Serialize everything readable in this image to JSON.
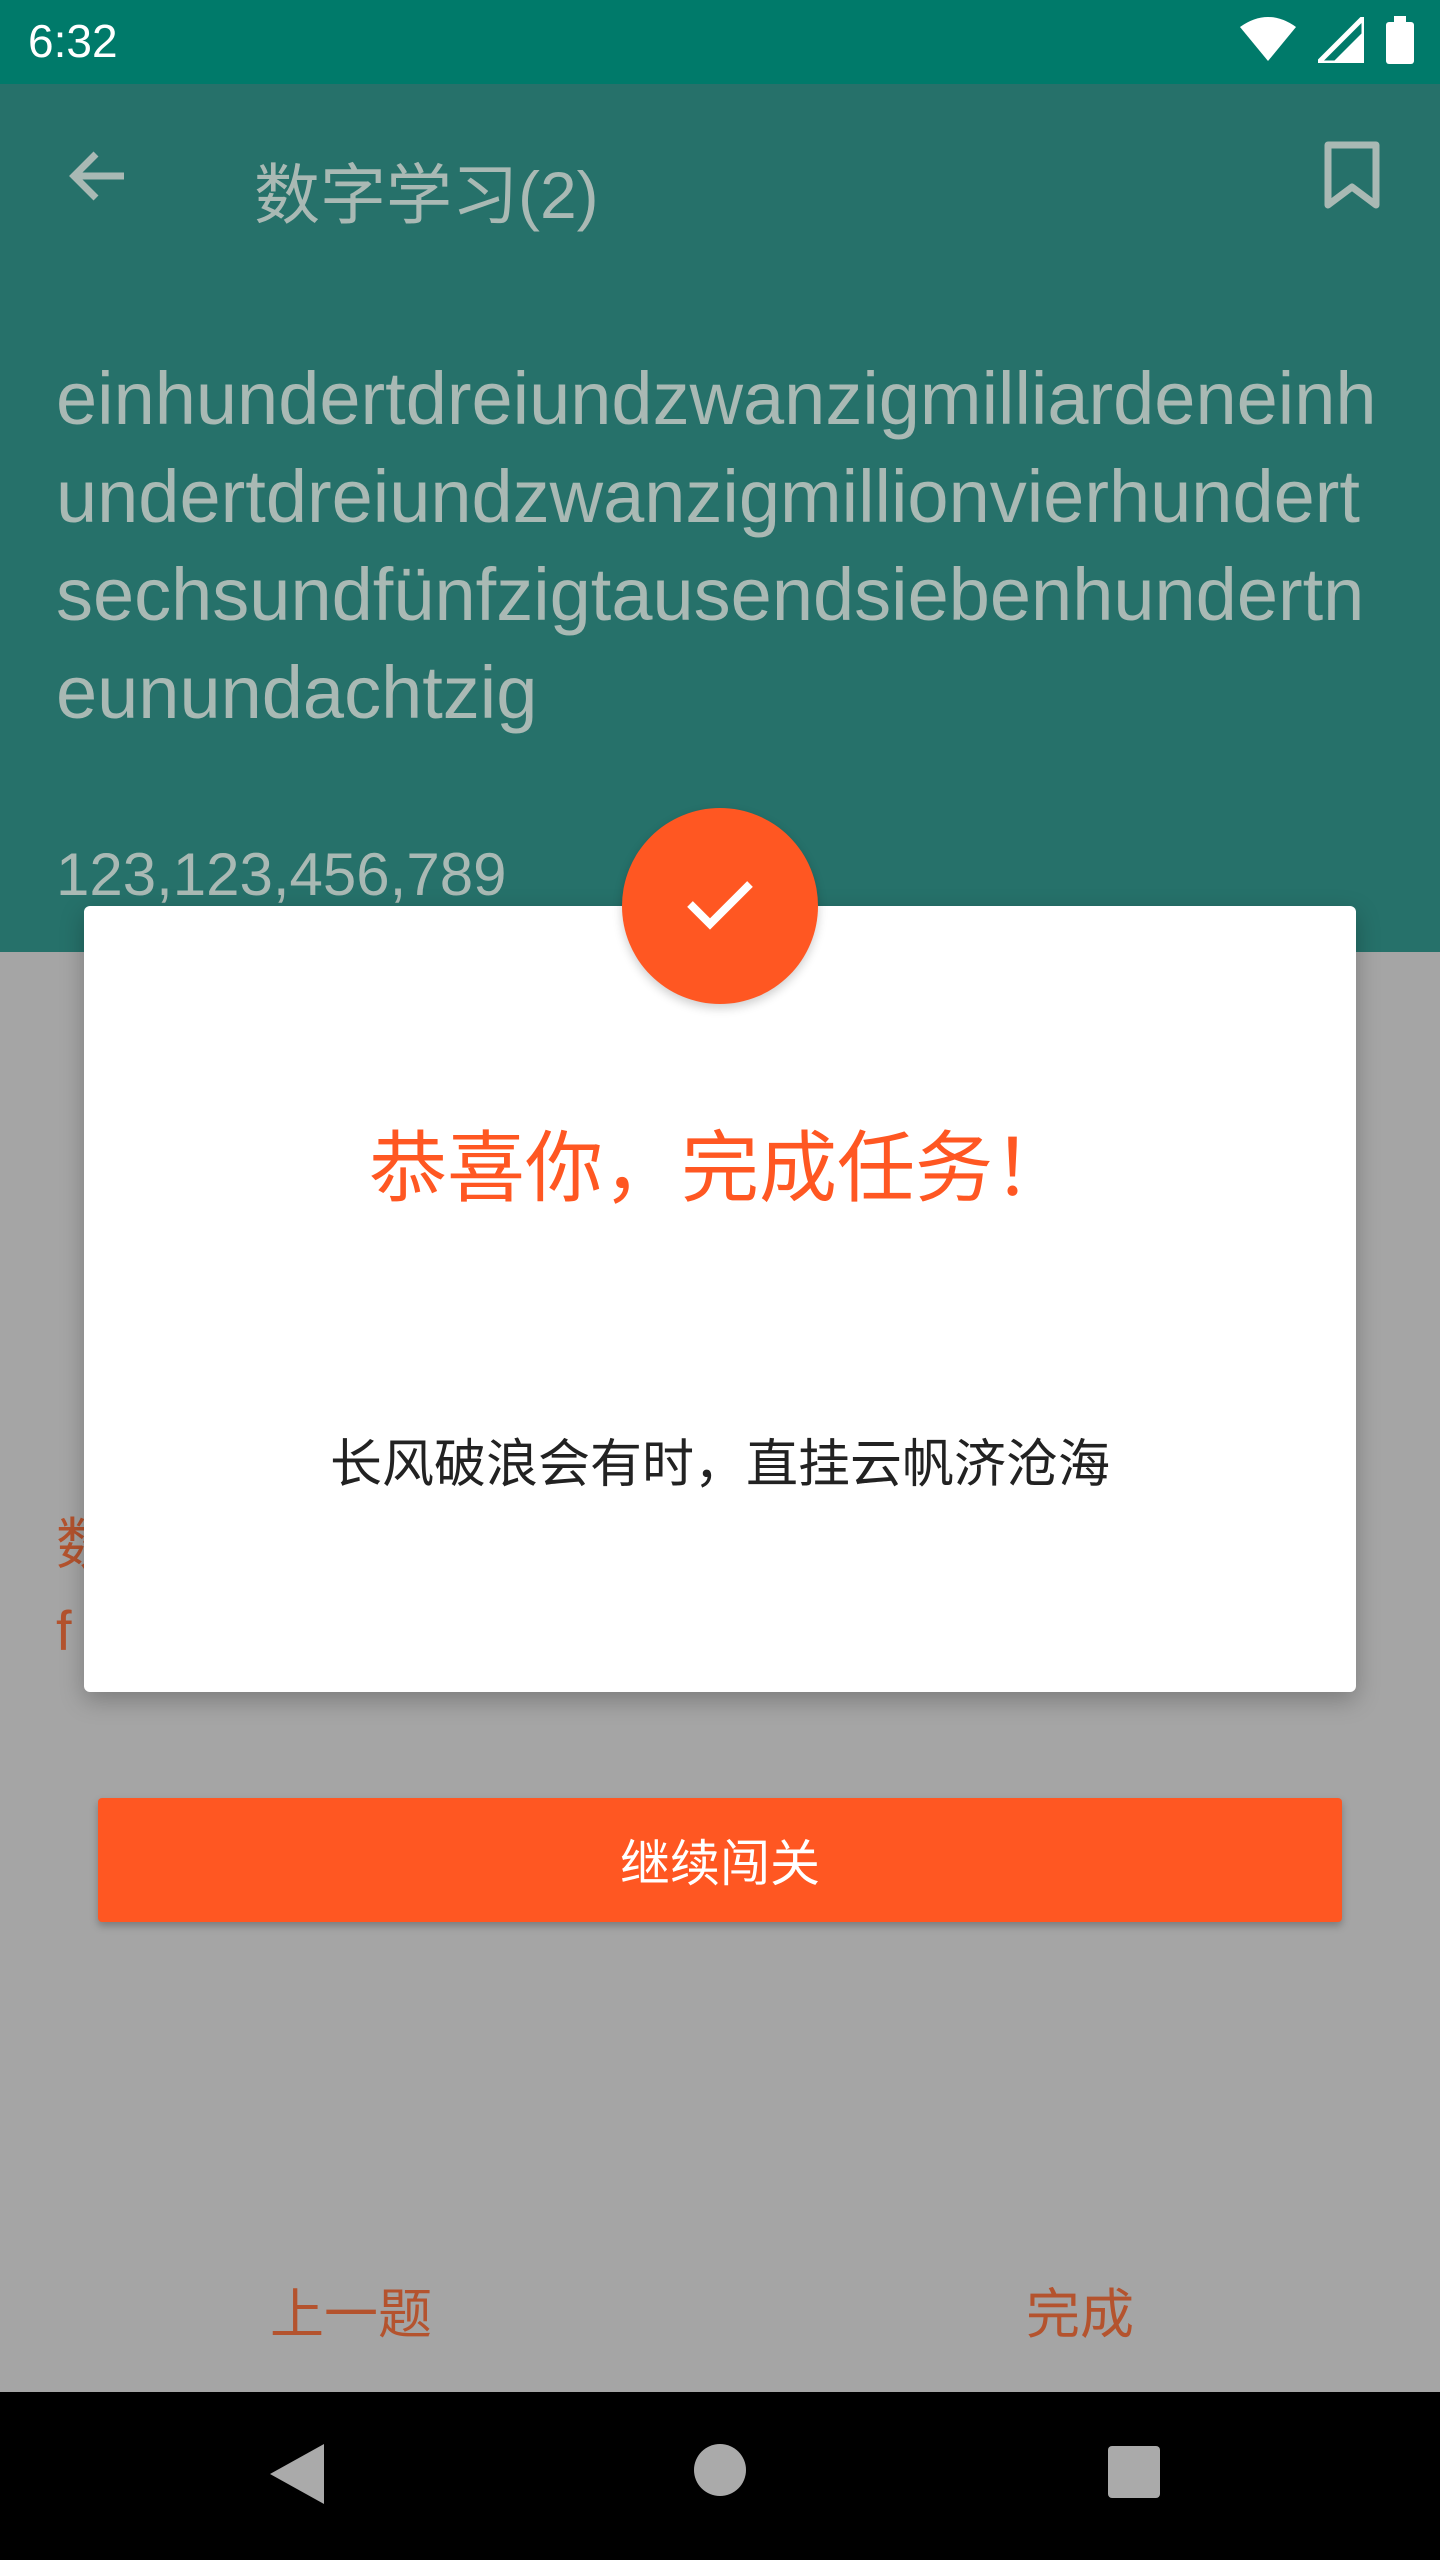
{
  "status_bar": {
    "time": "6:32",
    "icons": [
      "wifi-icon",
      "signal-icon",
      "battery-icon"
    ]
  },
  "toolbar": {
    "title": "数字学习(2)",
    "back_icon": "arrow-back-icon",
    "bookmark_icon": "bookmark-icon"
  },
  "word_panel": {
    "german_word": "einhundertdreiundzwanzigmilliardeneinhundertdreiundzwanzigmillionvierhundertsechsundfünfzigtausendsiebenhundertneunundachtzig",
    "number": "123,123,456,789"
  },
  "question": {
    "label": "数",
    "sub": "f"
  },
  "dialog": {
    "title": "恭喜你，完成任务！",
    "message": "长风破浪会有时，直挂云帆济沧海"
  },
  "continue_button": "继续闯关",
  "bottom_nav": {
    "prev": "上一题",
    "done": "完成"
  },
  "colors": {
    "primary": "#26716a",
    "status_bar": "#007a6a",
    "accent": "#ff5722"
  }
}
